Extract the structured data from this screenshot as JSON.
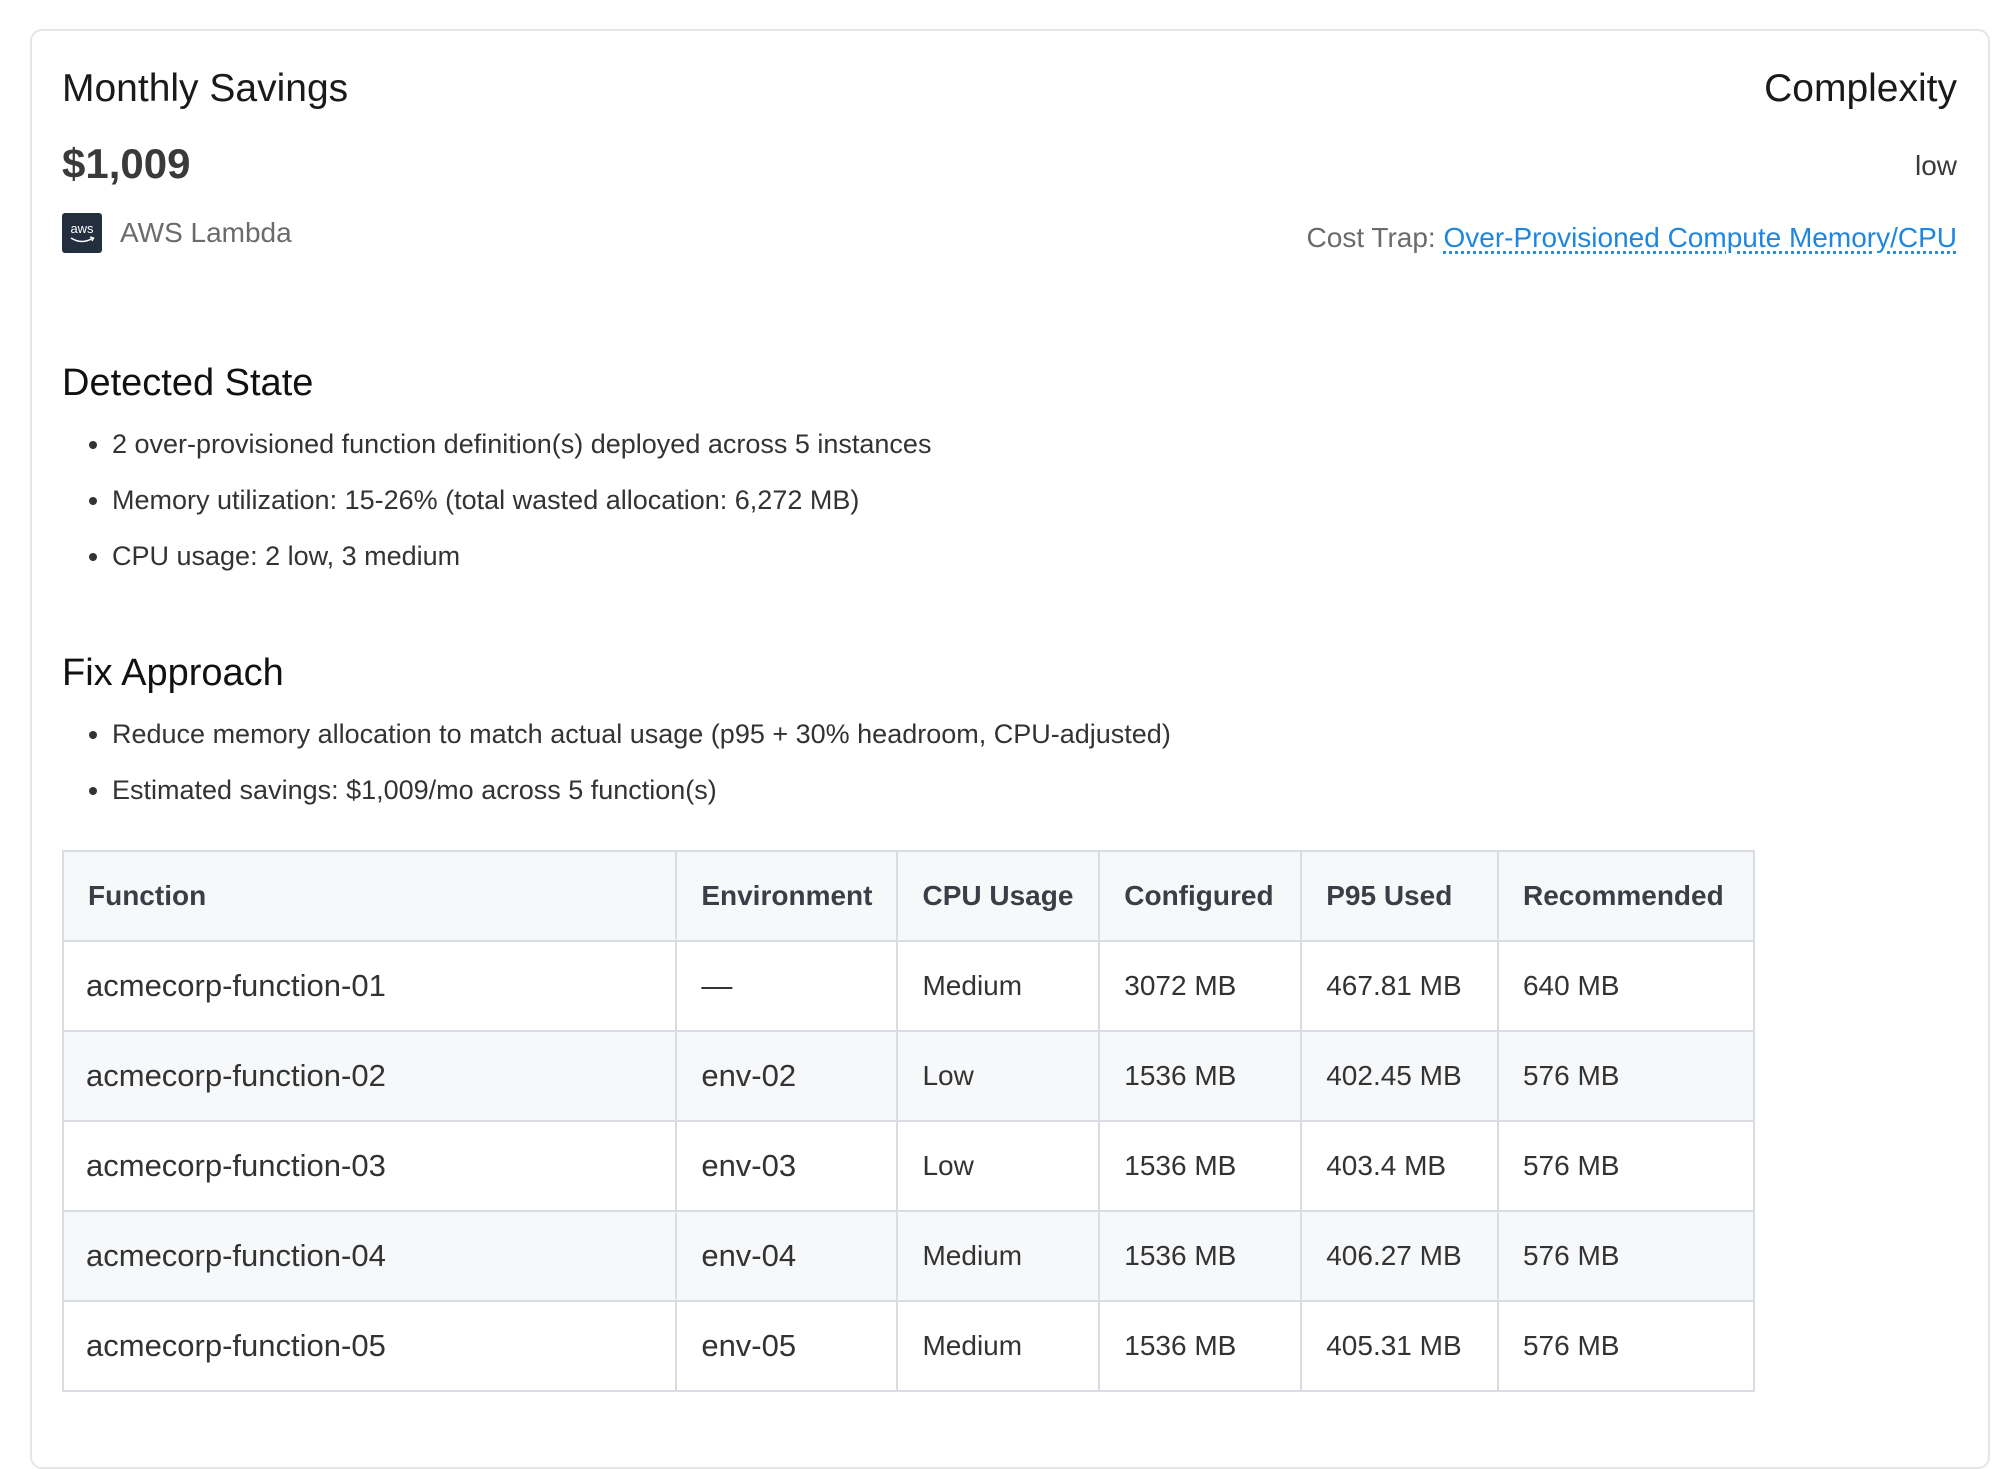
{
  "summary": {
    "title": "Monthly Savings",
    "value": "$1,009",
    "provider": "AWS Lambda",
    "provider_logo_text": "aws"
  },
  "complexity": {
    "title": "Complexity",
    "value": "low",
    "cost_trap_label": "Cost Trap:",
    "cost_trap_link": "Over-Provisioned Compute Memory/CPU"
  },
  "detected_state": {
    "title": "Detected State",
    "items": [
      "2 over-provisioned function definition(s) deployed across 5 instances",
      "Memory utilization: 15-26% (total wasted allocation: 6,272 MB)",
      "CPU usage: 2 low, 3 medium"
    ]
  },
  "fix_approach": {
    "title": "Fix Approach",
    "items": [
      "Reduce memory allocation to match actual usage (p95 + 30% headroom, CPU-adjusted)",
      "Estimated savings: $1,009/mo across 5 function(s)"
    ]
  },
  "table": {
    "headers": [
      "Function",
      "Environment",
      "CPU Usage",
      "Configured",
      "P95 Used",
      "Recommended"
    ],
    "rows": [
      [
        "acmecorp-function-01",
        "—",
        "Medium",
        "3072 MB",
        "467.81 MB",
        "640 MB"
      ],
      [
        "acmecorp-function-02",
        "env-02",
        "Low",
        "1536 MB",
        "402.45 MB",
        "576 MB"
      ],
      [
        "acmecorp-function-03",
        "env-03",
        "Low",
        "1536 MB",
        "403.4 MB",
        "576 MB"
      ],
      [
        "acmecorp-function-04",
        "env-04",
        "Medium",
        "1536 MB",
        "406.27 MB",
        "576 MB"
      ],
      [
        "acmecorp-function-05",
        "env-05",
        "Medium",
        "1536 MB",
        "405.31 MB",
        "576 MB"
      ]
    ]
  },
  "colors": {
    "link": "#1f86e0",
    "aws_logo_bg": "#232f3e",
    "table_border": "#d9dde3",
    "table_header_bg": "#f7f8fa"
  },
  "icons": {
    "provider": "aws-logo-icon"
  }
}
